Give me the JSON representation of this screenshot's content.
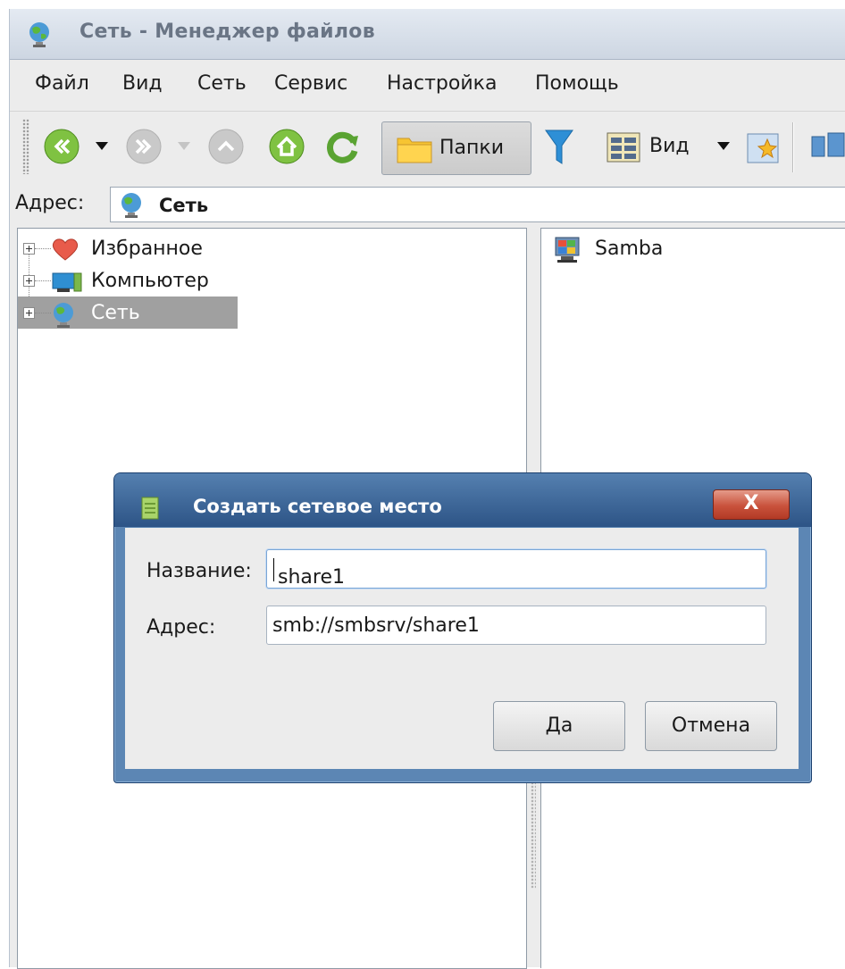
{
  "window": {
    "title": "Сеть - Менеджер файлов"
  },
  "menu": [
    "Файл",
    "Вид",
    "Сеть",
    "Сервис",
    "Настройка",
    "Помощь"
  ],
  "toolbar": {
    "folders_label": "Папки",
    "view_label": "Вид",
    "icons": [
      "back-icon",
      "forward-icon",
      "up-icon",
      "home-icon",
      "refresh-icon",
      "folder-icon",
      "filter-icon",
      "view-mode-icon",
      "new-item-icon",
      "network-icon"
    ]
  },
  "address": {
    "label": "Адрес:",
    "value": "Сеть"
  },
  "tree": [
    {
      "label": "Избранное",
      "icon": "heart-icon",
      "selected": false
    },
    {
      "label": "Компьютер",
      "icon": "computer-icon",
      "selected": false
    },
    {
      "label": "Сеть",
      "icon": "globe-icon",
      "selected": true
    }
  ],
  "files": [
    {
      "label": "Samba",
      "icon": "samba-icon"
    }
  ],
  "dialog": {
    "title": "Создать сетевое место",
    "close_label": "X",
    "name_label": "Название:",
    "name_value": "share1",
    "address_label": "Адрес:",
    "address_value": "smb://smbsrv/share1",
    "ok_label": "Да",
    "cancel_label": "Отмена"
  },
  "colors": {
    "accent": "#2d5486",
    "selection": "#a0a0a0",
    "close": "#c9523c"
  }
}
